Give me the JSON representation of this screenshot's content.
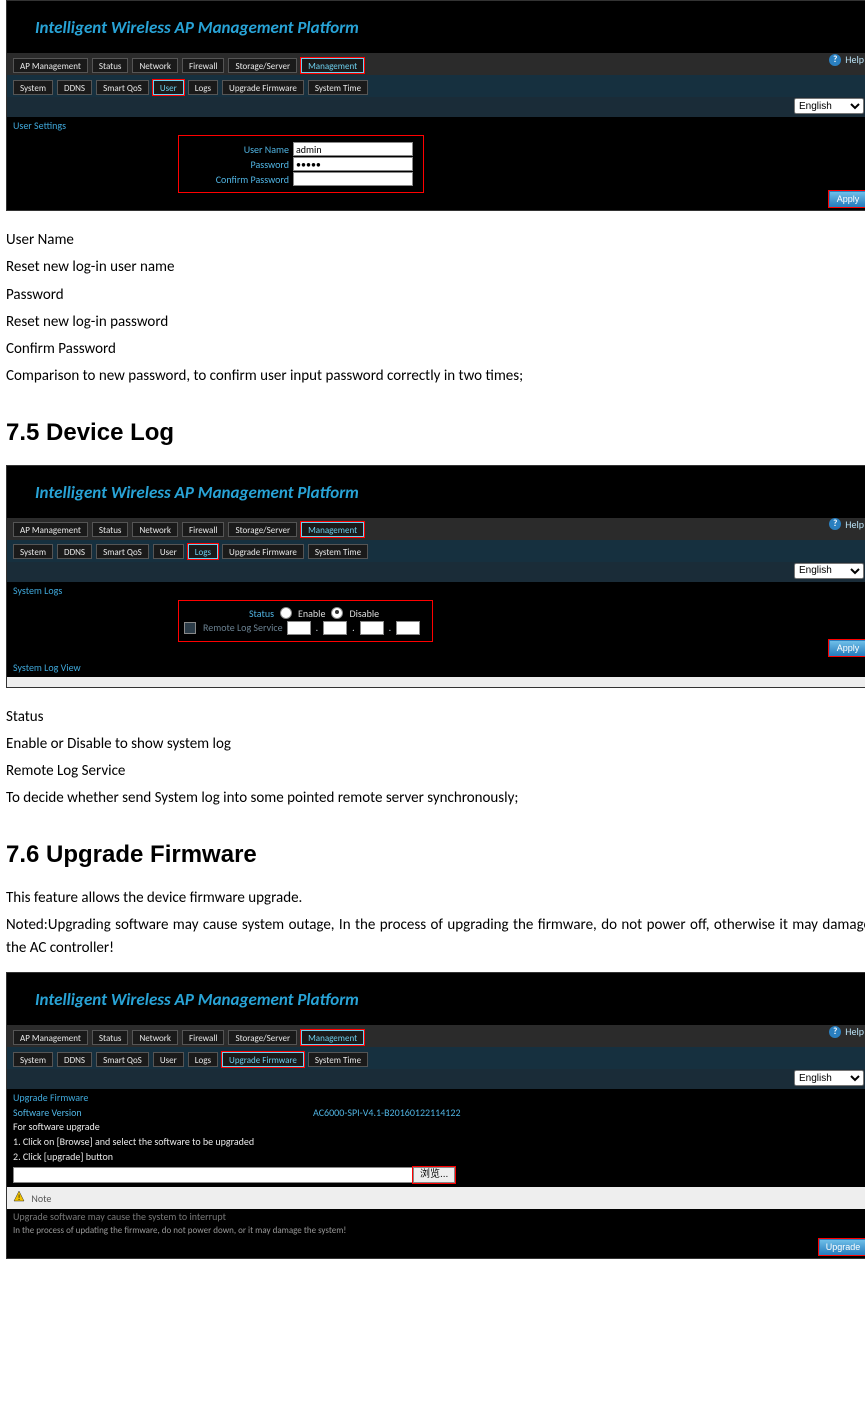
{
  "title": "Intelligent Wireless AP Management Platform",
  "nav1": [
    "AP Management",
    "Status",
    "Network",
    "Firewall",
    "Storage/Server",
    "Management"
  ],
  "nav2": [
    "System",
    "DDNS",
    "Smart QoS",
    "User",
    "Logs",
    "Upgrade Firmware",
    "System Time"
  ],
  "help": "Help",
  "lang": "English",
  "apply": "Apply",
  "user": {
    "section": "User Settings",
    "labels": [
      "User Name",
      "Password",
      "Confirm Password"
    ],
    "values": {
      "username": "admin",
      "password": "•••••",
      "confirm": ""
    }
  },
  "desc1": [
    "User Name",
    "Reset new log-in user name",
    "Password",
    "Reset new log-in password",
    "Confirm Password",
    "Comparison to new password, to confirm user input password correctly in two times;"
  ],
  "h75": "7.5    Device Log",
  "log": {
    "section": "System Logs",
    "status_lbl": "Status",
    "enable": "Enable",
    "disable": "Disable",
    "remote": "Remote Log Service",
    "view": "System Log View"
  },
  "desc2": [
    "Status",
    "Enable or Disable to show system log",
    "Remote Log Service",
    "To decide whether send System log into some pointed remote server synchronously;"
  ],
  "h76": "7.6    Upgrade Firmware",
  "desc3": [
    "This feature allows the device firmware upgrade.",
    "Noted:Upgrading software may cause system outage, In the process of upgrading the firmware, do not power off, otherwise it may damage the AC controller!"
  ],
  "upg": {
    "section": "Upgrade Firmware",
    "sv_lbl": "Software Version",
    "sv_val": "AC6000-SPI-V4.1-B20160122114122",
    "instr0": "For software upgrade",
    "instr1": "1. Click on [Browse] and select the software to be upgraded",
    "instr2": "2. Click [upgrade] button",
    "browse": "浏览...",
    "note": "Note",
    "warn1": "Upgrade software may cause the system to interrupt",
    "warn2": "In the process of updating the firmware, do not power down, or it may damage the system!",
    "btn": "Upgrade"
  }
}
